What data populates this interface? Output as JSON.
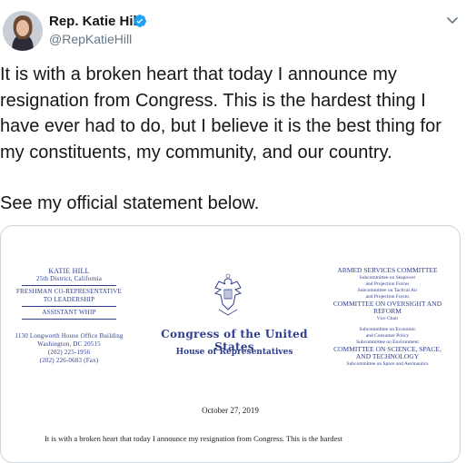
{
  "header": {
    "display_name": "Rep. Katie Hill",
    "handle": "@RepKatieHill",
    "verified_icon": "verified-badge-icon",
    "more_icon": "chevron-down-icon"
  },
  "tweet": {
    "paragraph1": "It is with a broken heart that today I announce my resignation from Congress. This is the hardest thing I have ever had to do, but I believe it is the best thing for my constituents, my community, and our country.",
    "paragraph2": "See my official statement below."
  },
  "statement": {
    "left": {
      "name": "KATIE HILL",
      "district": "25th District, California",
      "role1": "FRESHMAN CO-REPRESENTATIVE",
      "role2": "TO LEADERSHIP",
      "role3": "ASSISTANT WHIP",
      "addr1": "1130 Longworth House Office Building",
      "addr2": "Washington, DC 20515",
      "phone": "(202) 225-1956",
      "fax": "(202) 226-0683 (Fax)"
    },
    "center": {
      "congress": "Congress of the United States",
      "house": "House of Representatives"
    },
    "right": {
      "c1": "ARMED SERVICES COMMITTEE",
      "c1a": "Subcommittee on Seapower",
      "c1b": "and Projection Forces",
      "c1c": "Subcommittee on Tactical Air",
      "c1d": "and Projection Forces",
      "c2": "COMMITTEE ON OVERSIGHT AND REFORM",
      "c2a": "Vice Chair",
      "c2b": "Subcommittee on Economic",
      "c2c": "and Consumer Policy",
      "c2d": "Subcommittee on Environment",
      "c3": "COMMITTEE ON SCIENCE, SPACE,",
      "c3a": "AND TECHNOLOGY",
      "c3b": "Subcommittee on Space and Aeronautics"
    },
    "date": "October 27, 2019",
    "body": "It is with a broken heart that today I announce my resignation from Congress. This is the hardest"
  }
}
